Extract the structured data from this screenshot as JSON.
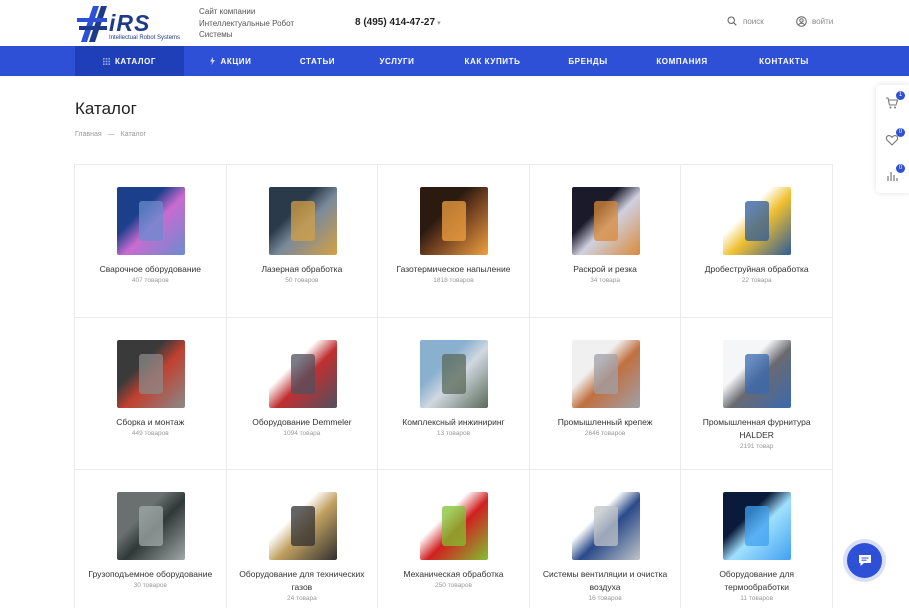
{
  "header": {
    "logo_text": "iRS",
    "logo_subtitle": "Intellectual Robot Systems",
    "site_description": "Сайт компании Интеллектуальные Робот Системы",
    "phone": "8 (495) 414-47-27",
    "search_label": "поиск",
    "login_label": "войти"
  },
  "nav": {
    "items": [
      {
        "label": "КАТАЛОГ"
      },
      {
        "label": "АКЦИИ"
      },
      {
        "label": "СТАТЬИ"
      },
      {
        "label": "УСЛУГИ"
      },
      {
        "label": "КАК КУПИТЬ"
      },
      {
        "label": "БРЕНДЫ"
      },
      {
        "label": "КОМПАНИЯ"
      },
      {
        "label": "КОНТАКТЫ"
      }
    ]
  },
  "side_panel": {
    "cart_count": "1",
    "favorites_count": "0",
    "compare_count": "0"
  },
  "page": {
    "title": "Каталог",
    "breadcrumb": [
      "Главная",
      "—",
      "Каталог"
    ]
  },
  "catalog": [
    {
      "title": "Сварочное оборудование",
      "count": "407 товаров",
      "icon": "welding-image",
      "colors": [
        "#1c3f8c",
        "#6a8ccf",
        "#c86bd0"
      ]
    },
    {
      "title": "Лазерная обработка",
      "count": "50 товаров",
      "icon": "laser-machine-image",
      "colors": [
        "#2a3a4a",
        "#d4a043",
        "#7a8a9a"
      ]
    },
    {
      "title": "Газотермическое напыление",
      "count": "1818 товаров",
      "icon": "thermal-spray-image",
      "colors": [
        "#2b1a10",
        "#f0a040",
        "#704020"
      ]
    },
    {
      "title": "Раскрой и резка",
      "count": "34 товара",
      "icon": "cutting-image",
      "colors": [
        "#1a1a2a",
        "#d88a3a",
        "#d0d0e0"
      ]
    },
    {
      "title": "Дробеструйная обработка",
      "count": "22 товара",
      "icon": "shot-blasting-image",
      "colors": [
        "#ffffff",
        "#2d5b9a",
        "#f0c030"
      ]
    },
    {
      "title": "Сборка и монтаж",
      "count": "449 товаров",
      "icon": "assembly-image",
      "colors": [
        "#3a3a3a",
        "#8a8a8a",
        "#c04030"
      ]
    },
    {
      "title": "Оборудование Demmeler",
      "count": "1094 товара",
      "icon": "welding-table-image",
      "colors": [
        "#ffffff",
        "#505060",
        "#c03030"
      ]
    },
    {
      "title": "Комплексный инжиниринг",
      "count": "13 товаров",
      "icon": "plant-image",
      "colors": [
        "#8ab0d0",
        "#5a6a5a",
        "#d0d8e0"
      ]
    },
    {
      "title": "Промышленный крепеж",
      "count": "2646 товаров",
      "icon": "fasteners-image",
      "colors": [
        "#f0f0f0",
        "#a0a0a8",
        "#c07040"
      ]
    },
    {
      "title": "Промышленная фурнитура HALDER",
      "count": "2191 товар",
      "icon": "halder-image",
      "colors": [
        "#f4f6f8",
        "#3a6ab0",
        "#6a6a70"
      ]
    },
    {
      "title": "Грузоподъемное оборудование",
      "count": "30 товаров",
      "icon": "lifting-image",
      "colors": [
        "#6a7070",
        "#a0a8a8",
        "#303838"
      ]
    },
    {
      "title": "Оборудование для технических газов",
      "count": "24 товара",
      "icon": "gas-regulator-image",
      "colors": [
        "#ffffff",
        "#303030",
        "#c0a060"
      ]
    },
    {
      "title": "Механическая обработка",
      "count": "250 товаров",
      "icon": "tools-image",
      "colors": [
        "#ffffff",
        "#80c030",
        "#d02020"
      ]
    },
    {
      "title": "Системы вентиляции и очистка воздуха",
      "count": "16 товаров",
      "icon": "ventilation-image",
      "colors": [
        "#ffffff",
        "#c0c4c8",
        "#2a4a8a"
      ]
    },
    {
      "title": "Оборудование для термообработки",
      "count": "11 товаров",
      "icon": "heat-treatment-image",
      "colors": [
        "#0a1a3a",
        "#40a0f0",
        "#a0e0ff"
      ]
    }
  ]
}
